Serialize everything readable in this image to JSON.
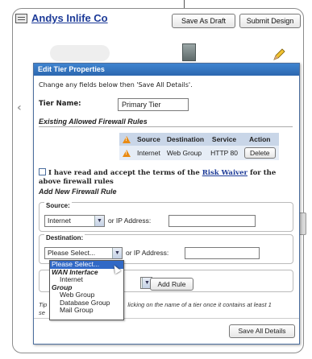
{
  "header": {
    "company_name": "Andys Inlife Co",
    "save_draft_label": "Save As Draft",
    "submit_label": "Submit Design"
  },
  "dialog": {
    "title": "Edit Tier Properties",
    "instructions": "Change any fields below then 'Save All Details'.",
    "tier_name_label": "Tier Name:",
    "tier_name_value": "Primary Tier",
    "rules_heading": "Existing Allowed Firewall Rules",
    "rules_table": {
      "headers": [
        "Source",
        "Destination",
        "Service",
        "Action"
      ],
      "rows": [
        {
          "source": "Internet",
          "destination": "Web Group",
          "service": "HTTP 80",
          "action_label": "Delete"
        }
      ]
    },
    "accept_text_pre": "I have read and accept the terms of the ",
    "accept_link": "Risk Waiver",
    "accept_text_post": " for the above firewall rules",
    "add_heading": "Add New Firewall Rule",
    "source": {
      "legend": "Source:",
      "selected": "Internet",
      "or_label": "or IP Address:",
      "ip_value": ""
    },
    "destination": {
      "legend": "Destination:",
      "selected": "Please Select...",
      "or_label": "or IP Address:",
      "ip_value": ""
    },
    "add_rule_label": "Add Rule",
    "tip_prefix": "Tip",
    "tip_suffix": "se",
    "tip_text": "licking on the name of a tier once it contains at least 1",
    "save_all_label": "Save All Details"
  },
  "dropdown": {
    "options": [
      {
        "label": "Please Select...",
        "type": "selected"
      },
      {
        "label": "WAN Interface",
        "type": "group"
      },
      {
        "label": "Internet",
        "type": "sub"
      },
      {
        "label": "Group",
        "type": "group"
      },
      {
        "label": "Web Group",
        "type": "sub"
      },
      {
        "label": "Database Group",
        "type": "sub"
      },
      {
        "label": "Mail Group",
        "type": "sub"
      }
    ]
  },
  "colors": {
    "titlebar": "#2c67b0",
    "link": "#1d3b98",
    "warning": "#e98b13",
    "table_header": "#c9d6e8",
    "selection": "#3169c6"
  }
}
